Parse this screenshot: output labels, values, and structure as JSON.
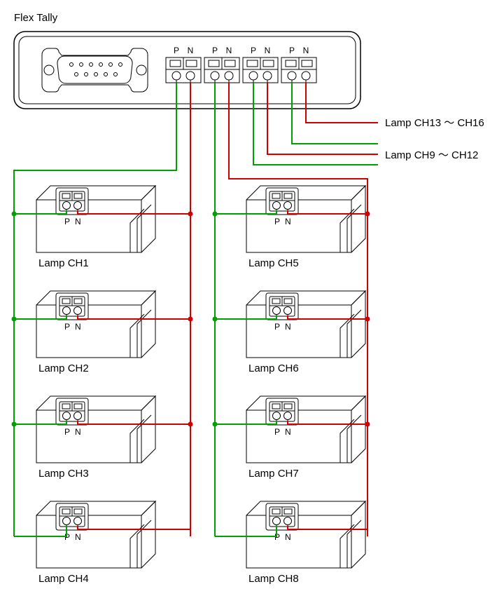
{
  "title": "Flex Tally",
  "header_terminal_labels": [
    "P",
    "N",
    "P",
    "N",
    "P",
    "N",
    "P",
    "N"
  ],
  "side_labels": {
    "top": "Lamp CH13 ～ CH16",
    "bottom": "Lamp CH9 ～ CH12"
  },
  "lamps": {
    "left": [
      {
        "name": "Lamp CH1",
        "p": "P",
        "n": "N"
      },
      {
        "name": "Lamp CH2",
        "p": "P",
        "n": "N"
      },
      {
        "name": "Lamp CH3",
        "p": "P",
        "n": "N"
      },
      {
        "name": "Lamp CH4",
        "p": "P",
        "n": "N"
      }
    ],
    "right": [
      {
        "name": "Lamp CH5",
        "p": "P",
        "n": "N"
      },
      {
        "name": "Lamp CH6",
        "p": "P",
        "n": "N"
      },
      {
        "name": "Lamp CH7",
        "p": "P",
        "n": "N"
      },
      {
        "name": "Lamp CH8",
        "p": "P",
        "n": "N"
      }
    ]
  },
  "wire_colors": {
    "p": "#00a000",
    "n": "#d00000"
  }
}
